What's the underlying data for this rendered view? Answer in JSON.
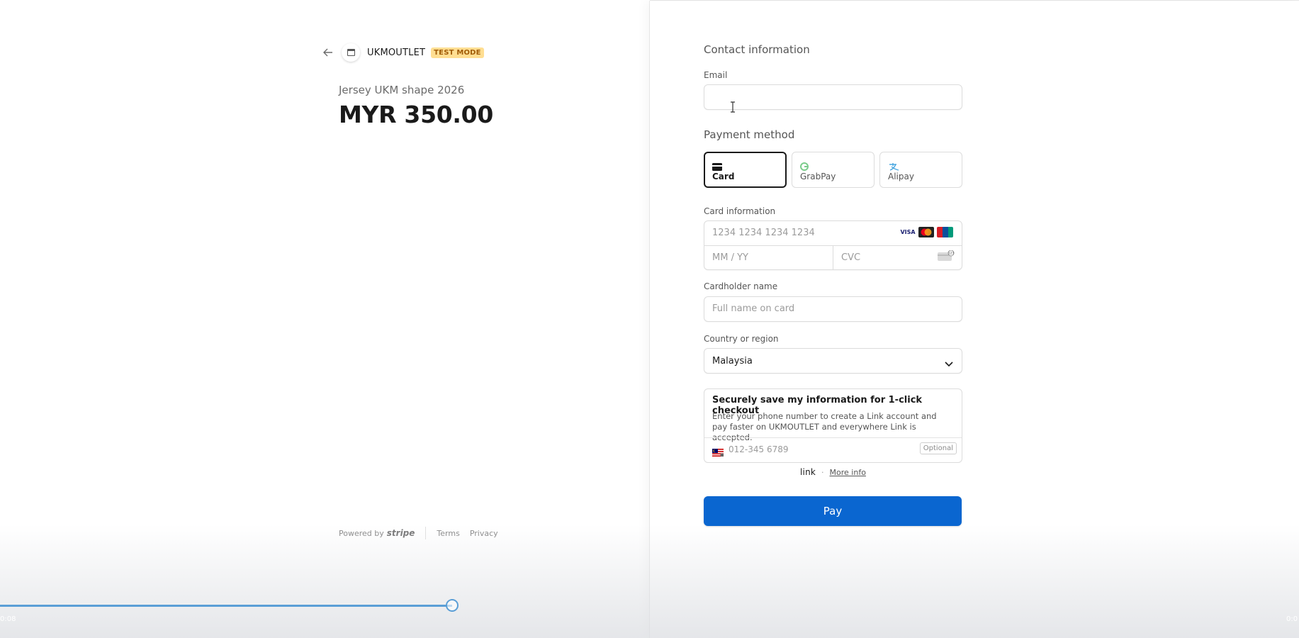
{
  "merchant": {
    "name": "UKMOUTLET",
    "test_mode_badge": "TEST MODE"
  },
  "product": {
    "name": "Jersey UKM shape 2026",
    "price": "MYR 350.00"
  },
  "footer": {
    "powered_by": "Powered by",
    "stripe": "stripe",
    "terms": "Terms",
    "privacy": "Privacy"
  },
  "contact": {
    "heading": "Contact information",
    "email_label": "Email",
    "email_value": ""
  },
  "payment": {
    "heading": "Payment method",
    "methods": [
      {
        "label": "Card",
        "icon": "card-icon",
        "selected": true
      },
      {
        "label": "GrabPay",
        "icon": "grabpay-icon",
        "selected": false
      },
      {
        "label": "Alipay",
        "icon": "alipay-icon",
        "selected": false
      }
    ]
  },
  "card": {
    "label": "Card information",
    "number_placeholder": "1234 1234 1234 1234",
    "expiry_placeholder": "MM / YY",
    "cvc_placeholder": "CVC",
    "brands": [
      "VISA",
      "mastercard",
      "UnionPay"
    ]
  },
  "cardholder": {
    "label": "Cardholder name",
    "placeholder": "Full name on card"
  },
  "country": {
    "label": "Country or region",
    "value": "Malaysia"
  },
  "link_save": {
    "title": "Securely save my information for 1-click checkout",
    "description": "Enter your phone number to create a Link account and pay faster on UKMOUTLET and everywhere Link is accepted.",
    "phone_placeholder": "012-345 6789",
    "optional": "Optional",
    "logo": "link",
    "more_info": "More info"
  },
  "pay_button": "Pay",
  "video": {
    "time_left": "0:08",
    "time_right": "0:0",
    "progress": 0.348
  },
  "colors": {
    "accent": "#0a66d0",
    "test_mode_bg": "#ffde92",
    "test_mode_fg": "#a15c07",
    "progress": "#5a9ed6"
  }
}
